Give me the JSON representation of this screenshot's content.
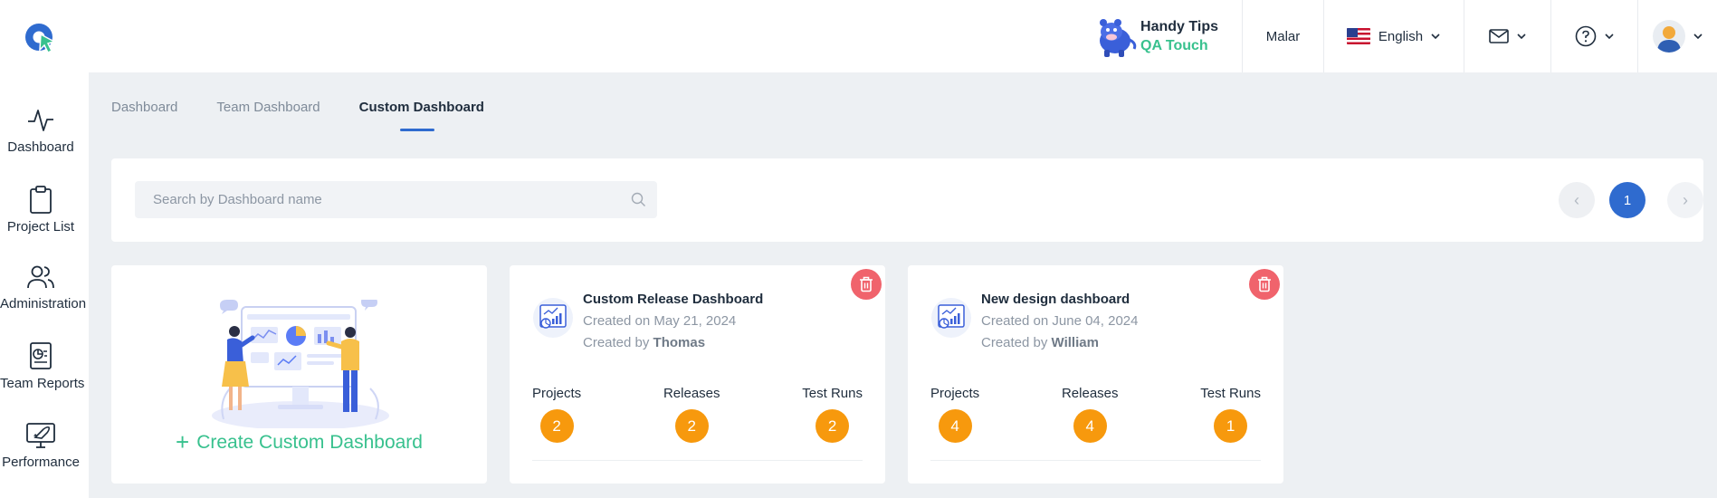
{
  "header": {
    "handy_tips_title": "Handy Tips",
    "handy_tips_brand": "QA Touch",
    "user_name": "Malar",
    "language": "English"
  },
  "sidebar": {
    "items": [
      {
        "label": "Dashboard",
        "icon": "activity-icon"
      },
      {
        "label": "Project List",
        "icon": "clipboard-icon"
      },
      {
        "label": "Administration",
        "icon": "users-icon"
      },
      {
        "label": "Team Reports",
        "icon": "report-icon"
      },
      {
        "label": "Performance",
        "icon": "rocket-monitor-icon"
      }
    ]
  },
  "tabs": [
    {
      "label": "Dashboard",
      "active": false
    },
    {
      "label": "Team Dashboard",
      "active": false
    },
    {
      "label": "Custom Dashboard",
      "active": true
    }
  ],
  "search": {
    "placeholder": "Search by Dashboard name",
    "value": ""
  },
  "pagination": {
    "prev": "‹",
    "current": "1",
    "next": "›"
  },
  "create_card": {
    "plus": "+",
    "label": "Create Custom Dashboard"
  },
  "dashboards": [
    {
      "title": "Custom Release Dashboard",
      "created_on": "Created on May 21, 2024",
      "created_by_prefix": "Created by",
      "created_by": "Thomas",
      "stats": [
        {
          "label": "Projects",
          "value": "2"
        },
        {
          "label": "Releases",
          "value": "2"
        },
        {
          "label": "Test Runs",
          "value": "2"
        }
      ]
    },
    {
      "title": "New design dashboard",
      "created_on": "Created on June 04, 2024",
      "created_by_prefix": "Created by",
      "created_by": "William",
      "stats": [
        {
          "label": "Projects",
          "value": "4"
        },
        {
          "label": "Releases",
          "value": "4"
        },
        {
          "label": "Test Runs",
          "value": "1"
        }
      ]
    }
  ],
  "colors": {
    "accent_blue": "#2f6bcf",
    "accent_green": "#38c18e",
    "badge_orange": "#f7990d",
    "delete_red": "#f0636c"
  }
}
